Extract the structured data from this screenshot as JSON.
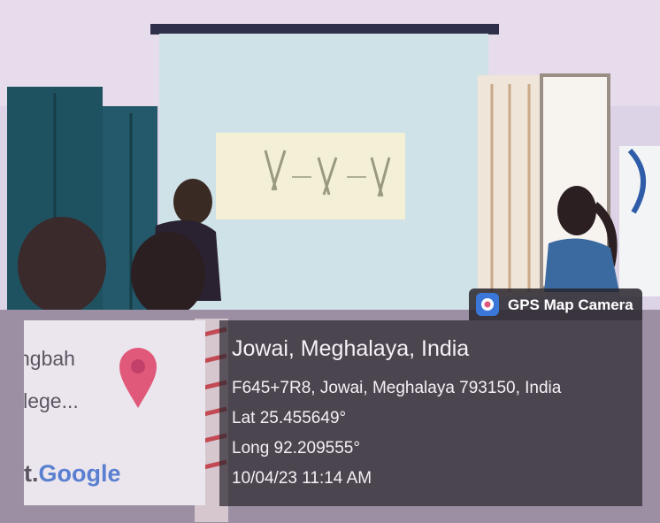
{
  "badge": {
    "label": "GPS Map Camera",
    "icon": "gps-camera-icon"
  },
  "map": {
    "label_line1": "ngbah",
    "label_line2": "llege...",
    "brand": "Google",
    "brand_prefix": "t.",
    "pin_icon": "location-pin-icon"
  },
  "info": {
    "place": "Jowai, Meghalaya, India",
    "address": "F645+7R8, Jowai, Meghalaya 793150, India",
    "lat": "Lat 25.455649°",
    "long": "Long 92.209555°",
    "datetime": "10/04/23 11:14 AM"
  },
  "slide": {
    "diagram": "chromosome-diagram"
  },
  "colors": {
    "pin": "#e0587a",
    "overlay_bg": "#2d2830",
    "badge_icon": "#3b77d8"
  }
}
